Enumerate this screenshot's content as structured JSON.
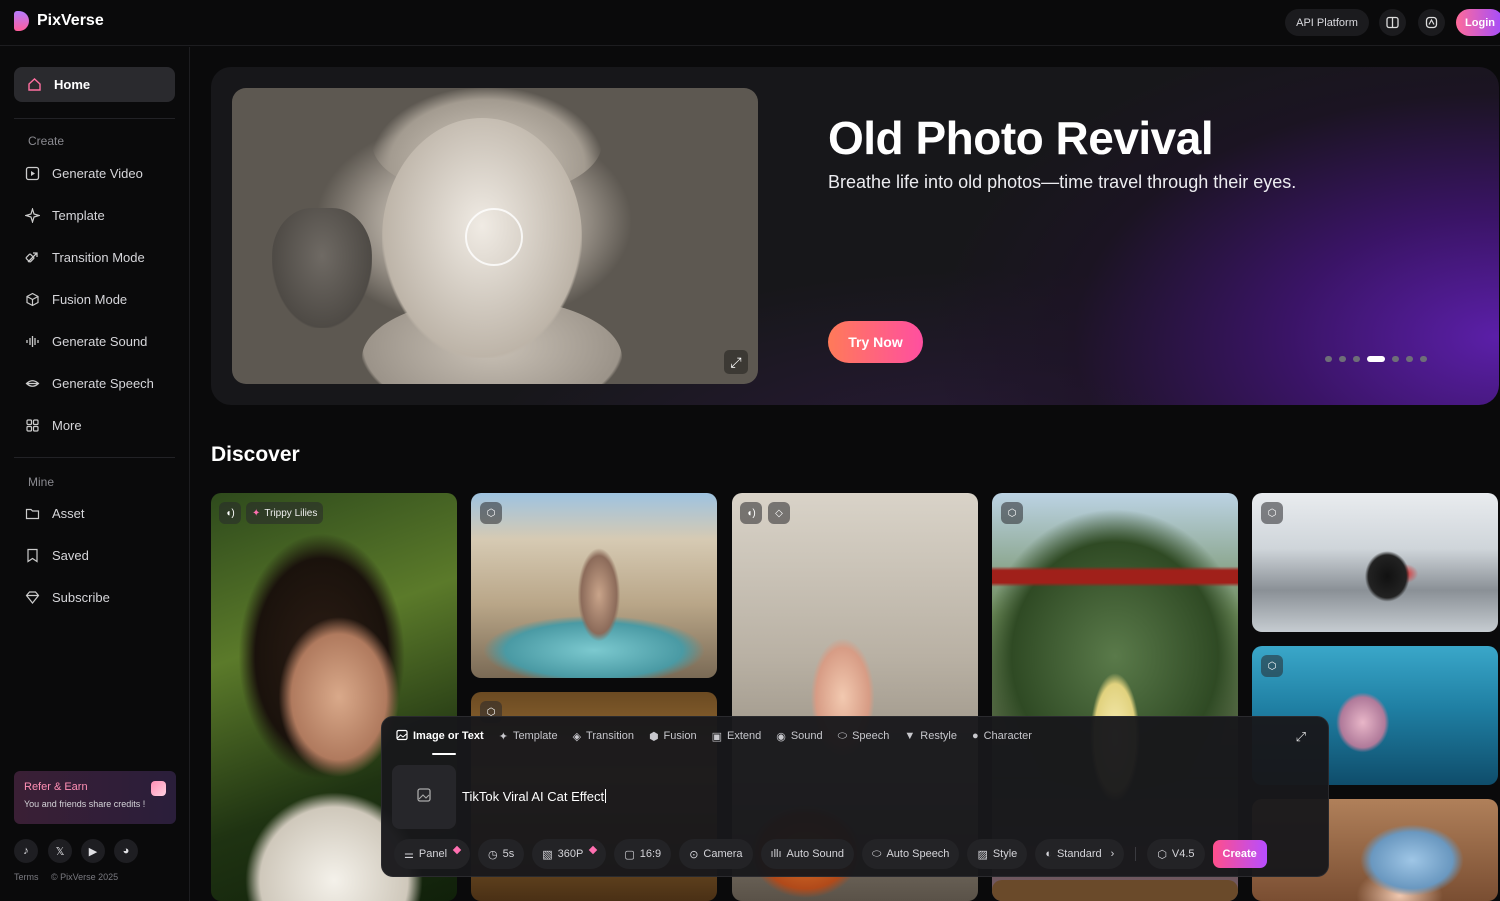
{
  "app": {
    "name": "PixVerse"
  },
  "header": {
    "api_label": "API Platform",
    "login_label": "Login"
  },
  "sidebar": {
    "home_label": "Home",
    "create_section": "Create",
    "create_items": [
      "Generate Video",
      "Template",
      "Transition Mode",
      "Fusion Mode",
      "Generate Sound",
      "Generate Speech",
      "More"
    ],
    "mine_section": "Mine",
    "mine_items": [
      "Asset",
      "Saved",
      "Subscribe"
    ],
    "refer_title": "Refer & Earn",
    "refer_text": "You and friends share credits !",
    "footer_terms": "Terms",
    "footer_copyright": "© PixVerse 2025"
  },
  "hero": {
    "title": "Old Photo Revival",
    "subtitle": "Breathe life into old photos—time travel through their eyes.",
    "cta": "Try Now",
    "slide_count": 7,
    "active_slide": 4
  },
  "discover": {
    "title": "Discover",
    "first_card_tag": "Trippy Lilies"
  },
  "composer": {
    "tabs": [
      "Image or Text",
      "Template",
      "Transition",
      "Fusion",
      "Extend",
      "Sound",
      "Speech",
      "Restyle",
      "Character"
    ],
    "active_tab": "Image or Text",
    "prompt_value": "TikTok Viral AI Cat Effect",
    "chips": {
      "panel": "Panel",
      "duration": "5s",
      "resolution": "360P",
      "ratio": "16:9",
      "camera": "Camera",
      "auto_sound": "Auto Sound",
      "auto_speech": "Auto Speech",
      "style": "Style",
      "quality": "Standard",
      "version": "V4.5"
    },
    "create_label": "Create"
  },
  "colors": {
    "accent_pink": "#ff4f8b",
    "accent_purple": "#b74dff",
    "background": "#0a0a0b"
  }
}
